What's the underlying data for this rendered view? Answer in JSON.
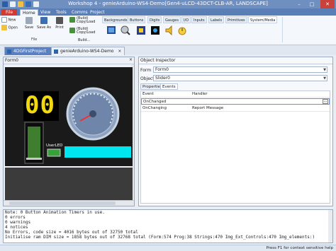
{
  "window": {
    "title": "Workshop 4 - genieArduino-WS4-Demo[Gen4-uLCD-43DCT-CLB-AR, LANDSCAPE]",
    "controls": [
      "–",
      "□",
      "✕"
    ]
  },
  "menu": {
    "tabs": [
      "File",
      "Home",
      "View",
      "Tools",
      "Comms",
      "Project"
    ]
  },
  "ribbon": {
    "file_group": {
      "label": "File",
      "new": "New",
      "open": "Open",
      "save": "Save",
      "save_as": "Save As",
      "print": "Print"
    },
    "build": {
      "build_copy": "(Build)\nCopy/Load",
      "build_copy2": "(Build)\nCopy/Load",
      "extra": "Build..."
    },
    "widget_tabs": [
      "Backgrounds",
      "Buttons",
      "Digits",
      "Gauges",
      "I/O",
      "Inputs",
      "Labels",
      "Primitives",
      "System/Media"
    ],
    "active_widget_tab": "System/Media"
  },
  "doc_tabs": [
    {
      "label": "4DGFirstProject",
      "active": true
    },
    {
      "label": "genieArduino-WS4-Demo",
      "active": false
    }
  ],
  "form_panel": {
    "title": "Form0",
    "canvas": {
      "digits_value": "00",
      "userled_label": "UserLED"
    }
  },
  "inspector": {
    "title": "Object Inspector",
    "form_label": "Form",
    "form_value": "Form0",
    "object_label": "Object",
    "object_value": "Slider0",
    "tabs": [
      "Properties",
      "Events"
    ],
    "active_tab": "Events",
    "grid_header": {
      "col1": "Event",
      "col2": "Handler"
    },
    "rows": [
      {
        "event": "OnChanged",
        "handler": ""
      },
      {
        "event": "OnChanging",
        "handler": "Report Message"
      }
    ]
  },
  "output": {
    "lines": [
      "Note: 0 Button Animation Timers in use.",
      "0 errors",
      "0 warnings",
      "4 notices",
      "No Errors, code size = 4016 bytes out of 32750 total",
      "Initialise ram DIM size = 1858 bytes out of 32768 total (Form:574 Prog:38 Strings:470 Img_Ext_Controls:470 Img_elements:)"
    ]
  },
  "status": {
    "left": "",
    "right": "Press F1 for context sensitive help"
  },
  "colors": {
    "titlebar": "#6f8fc0",
    "file_tab": "#d33a32",
    "digit_yellow": "#f2d90f",
    "cyan_bar": "#00e6f0",
    "slider_green": "#3f7e2e"
  }
}
